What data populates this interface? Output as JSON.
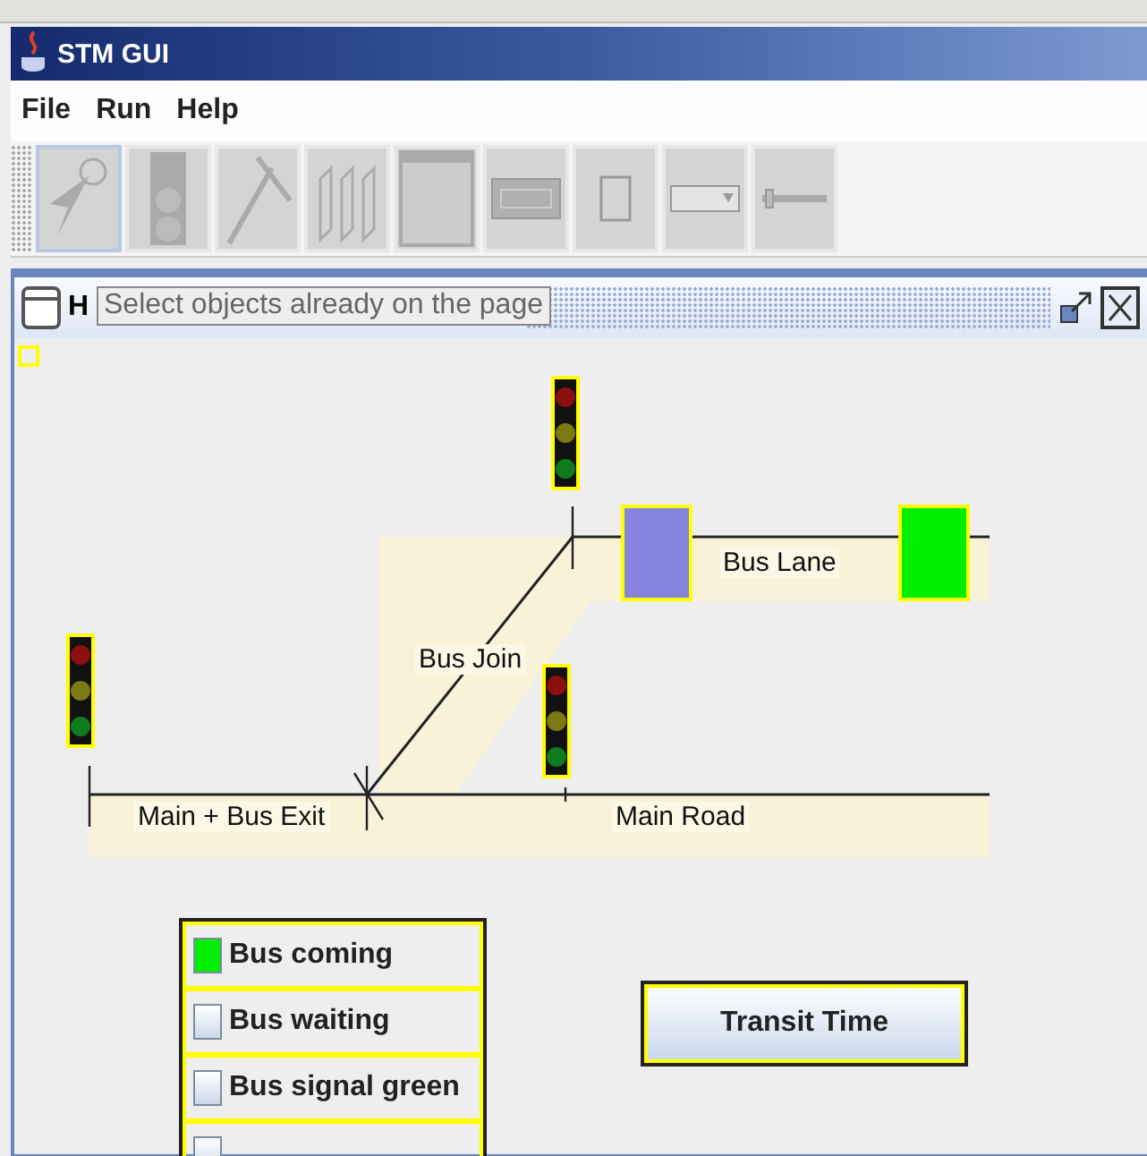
{
  "window": {
    "title": "STM GUI"
  },
  "menu": [
    "File",
    "Run",
    "Help"
  ],
  "toolbar": [
    {
      "kind": "pointer",
      "selected": true
    },
    {
      "kind": "signal",
      "selected": false
    },
    {
      "kind": "road",
      "selected": false
    },
    {
      "kind": "lanes",
      "selected": false
    },
    {
      "kind": "panel",
      "selected": false
    },
    {
      "kind": "button",
      "selected": false
    },
    {
      "kind": "checkbox",
      "selected": false
    },
    {
      "kind": "combo",
      "selected": false
    },
    {
      "kind": "slider",
      "selected": false
    }
  ],
  "frame": {
    "title": "H",
    "tooltip": "Select objects already on the page"
  },
  "roads": [
    {
      "label": "Bus Lane"
    },
    {
      "label": "Bus Join"
    },
    {
      "label": "Main + Bus Exit"
    },
    {
      "label": "Main Road"
    }
  ],
  "sensors": [
    {
      "color": "#8484dc"
    },
    {
      "color": "#00ee00"
    }
  ],
  "checks": [
    {
      "label": "Bus coming",
      "checked": true
    },
    {
      "label": "Bus waiting",
      "checked": false
    },
    {
      "label": "Bus signal green",
      "checked": false
    },
    {
      "checked": false
    }
  ],
  "button": "Transit Time"
}
